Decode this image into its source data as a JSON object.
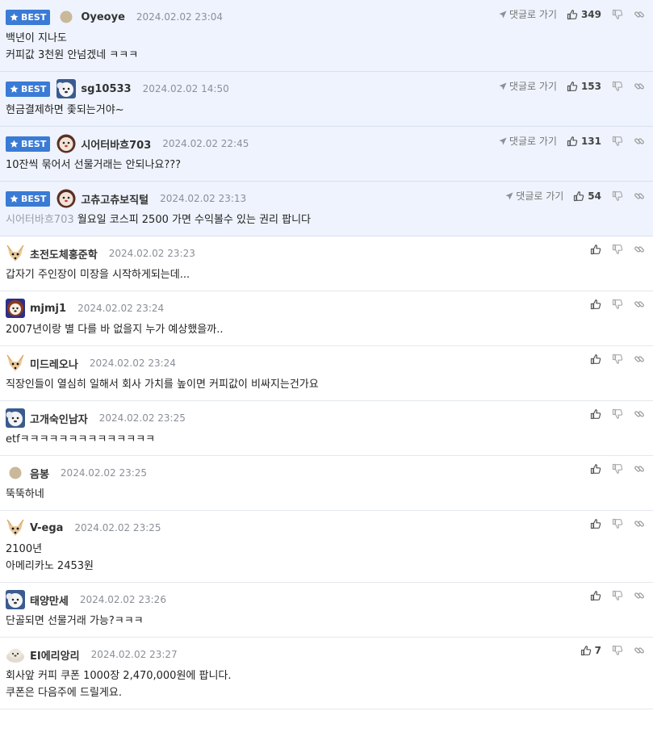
{
  "ui": {
    "best_label": "BEST",
    "reply_label": "댓글로 가기"
  },
  "comments": [
    {
      "best": true,
      "avatar": "dot-icon",
      "nick": "Oyeoye",
      "date": "2024.02.02 23:04",
      "likes": "349",
      "lines": [
        "백년이 지나도",
        "커피값 3천원 안넘겠네 ㅋㅋㅋ"
      ]
    },
    {
      "best": true,
      "avatar": "white-dog-avatar",
      "nick": "sg10533",
      "date": "2024.02.02 14:50",
      "likes": "153",
      "lines": [
        "현금결제하면 좇되는거야~"
      ]
    },
    {
      "best": true,
      "avatar": "fluffy-dog-avatar",
      "nick": "시어터바흐703",
      "date": "2024.02.02 22:45",
      "likes": "131",
      "lines": [
        "10잔씩 묶어서 선물거래는 안되나요???"
      ]
    },
    {
      "best": true,
      "avatar": "fluffy-dog-avatar",
      "nick": "고츄고츄보직털",
      "date": "2024.02.02 23:13",
      "likes": "54",
      "mention": "시어터바흐703",
      "lines": [
        " 월요일 코스피 2500 가면 수익볼수 있는 권리 팝니다"
      ]
    },
    {
      "best": false,
      "avatar": "fox-avatar",
      "nick": "초전도체홍준학",
      "date": "2024.02.02 23:23",
      "likes": "",
      "lines": [
        "갑자기 주인장이 미장을 시작하게되는데..."
      ]
    },
    {
      "best": false,
      "avatar": "lion-avatar",
      "nick": "mjmj1",
      "date": "2024.02.02 23:24",
      "likes": "",
      "lines": [
        "2007년이랑 별 다를 바 없을지 누가 예상했을까.."
      ]
    },
    {
      "best": false,
      "avatar": "fox-avatar",
      "nick": "미드레오나",
      "date": "2024.02.02 23:24",
      "likes": "",
      "lines": [
        "직장인들이 열심히 일해서 회사 가치를 높이면 커피값이 비싸지는건가요"
      ]
    },
    {
      "best": false,
      "avatar": "white-dog-avatar",
      "nick": "고개숙인남자",
      "date": "2024.02.02 23:25",
      "likes": "",
      "lines": [
        "etfㅋㅋㅋㅋㅋㅋㅋㅋㅋㅋㅋㅋㅋㅋ"
      ]
    },
    {
      "best": false,
      "avatar": "dot-icon",
      "nick": "음봉",
      "date": "2024.02.02 23:25",
      "likes": "",
      "lines": [
        "뚝뚝하네"
      ]
    },
    {
      "best": false,
      "avatar": "fox-avatar",
      "nick": "V-ega",
      "date": "2024.02.02 23:25",
      "likes": "",
      "lines": [
        "2100년",
        "아메리카노 2453원"
      ]
    },
    {
      "best": false,
      "avatar": "white-dog-avatar",
      "nick": "태양만세",
      "date": "2024.02.02 23:26",
      "likes": "",
      "lines": [
        "단골되면 선물거래 가능?ㅋㅋㅋ"
      ]
    },
    {
      "best": false,
      "avatar": "seal-avatar",
      "nick": "EI에리앙리",
      "date": "2024.02.02 23:27",
      "likes": "7",
      "lines": [
        "회사앞 커피 쿠폰 1000장 2,470,000원에 팝니다.",
        "쿠폰은 다음주에 드릴게요."
      ]
    }
  ]
}
